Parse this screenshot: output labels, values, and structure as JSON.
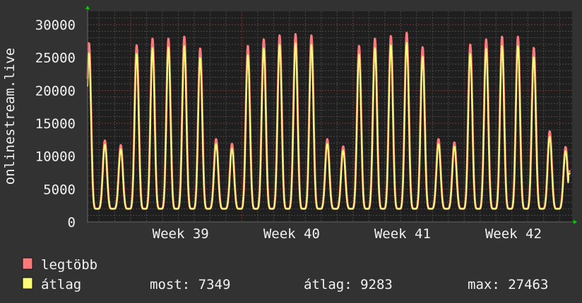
{
  "chart_data": {
    "type": "line",
    "ylabel": "onlinestream.live",
    "ylim": [
      0,
      30000
    ],
    "yticks": [
      "0",
      "5000",
      "10000",
      "15000",
      "20000",
      "25000",
      "30000"
    ],
    "ytick_values": [
      0,
      5000,
      10000,
      15000,
      20000,
      25000,
      30000
    ],
    "xlim_days": [
      0,
      30.5
    ],
    "xticks": [
      {
        "label": "Week 39",
        "start_day": 2.71
      },
      {
        "label": "Week 40",
        "start_day": 9.7
      },
      {
        "label": "Week 41",
        "start_day": 16.68
      },
      {
        "label": "Week 42",
        "start_day": 23.66
      }
    ],
    "grid": true,
    "trough": 2000,
    "last_value": 7349,
    "series": [
      {
        "name": "legtöbb",
        "color": "#ff7b7b",
        "daily_peaks": [
          27200,
          12400,
          11700,
          26900,
          27900,
          27900,
          28200,
          26400,
          12600,
          11900,
          26800,
          27800,
          28400,
          28600,
          28400,
          12600,
          11500,
          26800,
          27900,
          28300,
          28800,
          26600,
          12600,
          12100,
          27000,
          27800,
          28200,
          28200,
          26500,
          13800,
          11400
        ]
      },
      {
        "name": "átlag",
        "color": "#ffff77",
        "daily_peaks": [
          25700,
          11800,
          11100,
          25600,
          26500,
          26600,
          26800,
          25000,
          11900,
          11200,
          25400,
          26400,
          27000,
          27200,
          27000,
          11900,
          10900,
          25500,
          26500,
          26900,
          27300,
          25200,
          11900,
          11500,
          25600,
          26400,
          26800,
          26800,
          25100,
          13000,
          10800
        ]
      }
    ],
    "legend": {
      "placement": "bottom-left",
      "items": [
        {
          "label": "legtöbb",
          "color": "#ff7b7b"
        },
        {
          "label": "átlag",
          "color": "#ffff77"
        }
      ],
      "stats": {
        "now": "most: 7349",
        "avg": "átlag: 9283",
        "max": "max: 27463"
      }
    }
  }
}
